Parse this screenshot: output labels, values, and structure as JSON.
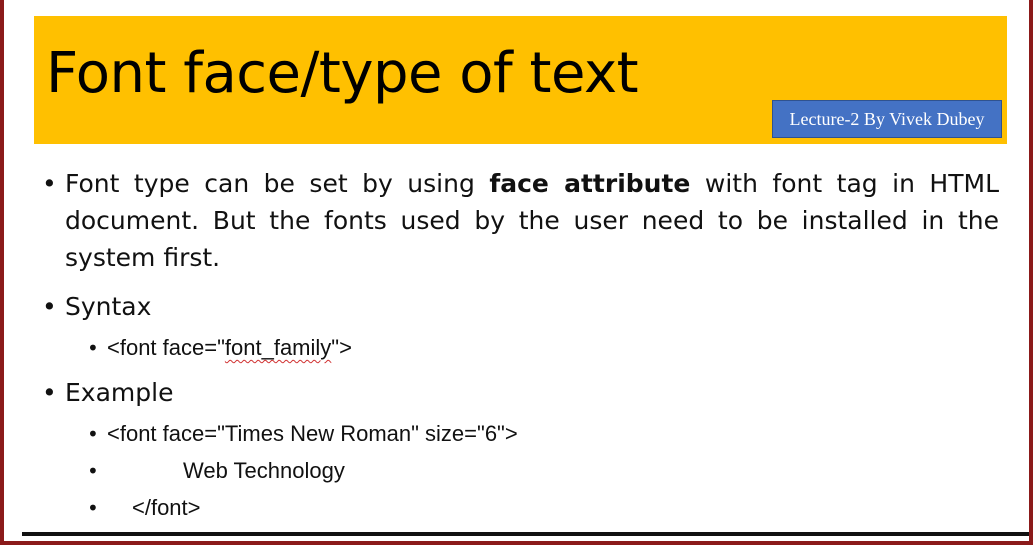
{
  "slide": {
    "title": "Font face/type of text",
    "badge": "Lecture-2 By Vivek Dubey",
    "bullet_glyph": "•",
    "paragraph": {
      "before": "Font type can be set by using ",
      "bold": "face attribute",
      "after": " with font tag in HTML document. But the fonts used by the user need to be installed in the system first."
    },
    "syntax": {
      "label": "Syntax",
      "code_before": "<font face=\"",
      "code_squiggle": "font_family",
      "code_after": "\">"
    },
    "example": {
      "label": "Example",
      "lines": [
        "<font face=\"Times New Roman\" size=\"6\">",
        "Web Technology",
        "</font>"
      ]
    }
  },
  "colors": {
    "title_band": "#ffc000",
    "badge_bg": "#4472c4",
    "frame": "#8b1a1a"
  }
}
